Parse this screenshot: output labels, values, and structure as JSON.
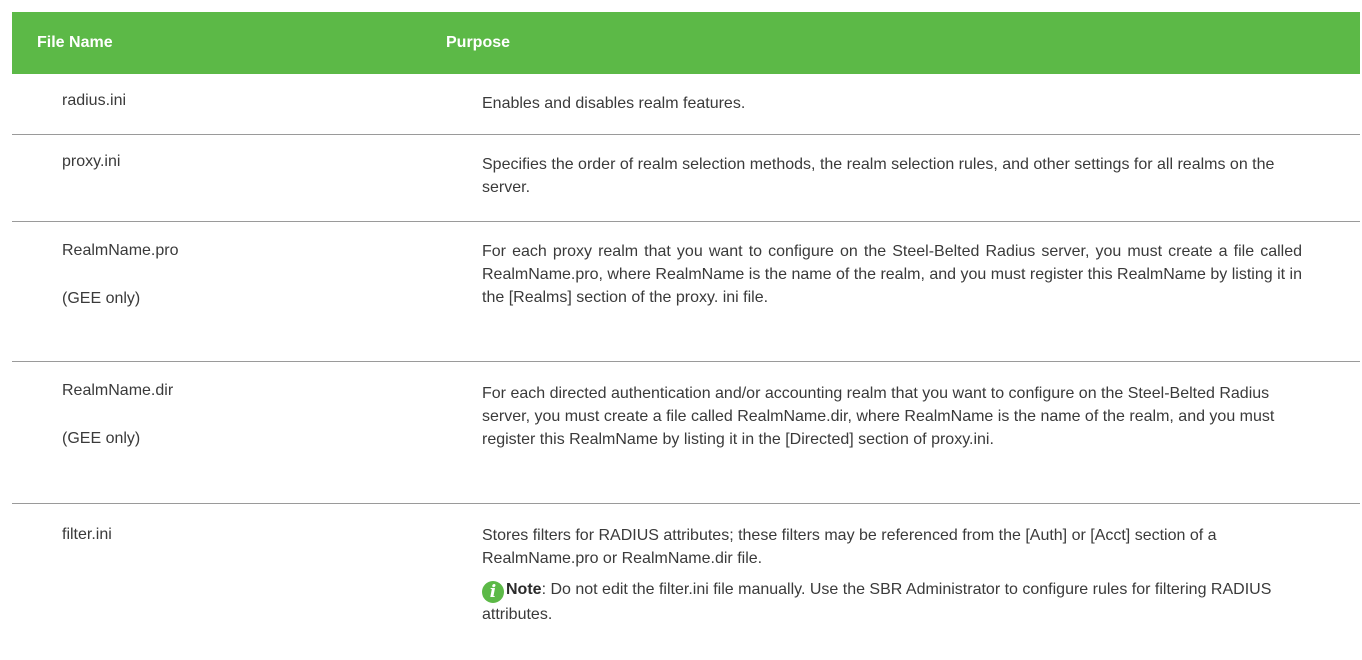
{
  "table": {
    "header": {
      "file_name": "File Name",
      "purpose": "Purpose"
    },
    "rows": [
      {
        "name": "radius.ini",
        "note": "",
        "purpose": "Enables and disables realm features."
      },
      {
        "name": "proxy.ini",
        "note": "",
        "purpose": "Specifies the order of realm selection methods, the realm selection rules, and other settings for all realms on the server."
      },
      {
        "name": "RealmName.pro",
        "note": "(GEE only)",
        "purpose": "For each proxy realm that you want to configure on the Steel-Belted Radius server, you must create a file called RealmName.pro, where RealmName is the name of the realm, and you must register this RealmName by listing it in the [Realms] section of the proxy. ini file."
      },
      {
        "name": "RealmName.dir",
        "note": "(GEE only)",
        "purpose": "For each directed authentication and/or accounting realm that you want to configure on the Steel-Belted Radius server, you must create a file called RealmName.dir, where RealmName is the name of the realm, and you must register this RealmName by listing it in the [Directed] section of proxy.ini."
      },
      {
        "name": "filter.ini",
        "note": "",
        "purpose": "Stores filters for RADIUS attributes; these filters may be referenced from the [Auth] or [Acct] section of a RealmName.pro or RealmName.dir file.",
        "callout": {
          "icon": "info-icon",
          "label": "Note",
          "text": ": Do not edit the filter.ini file manually. Use the SBR Administrator to configure rules   for filtering RADIUS attributes."
        }
      }
    ]
  },
  "colors": {
    "header_bg": "#5cb947",
    "note_icon": "#5cb947"
  }
}
